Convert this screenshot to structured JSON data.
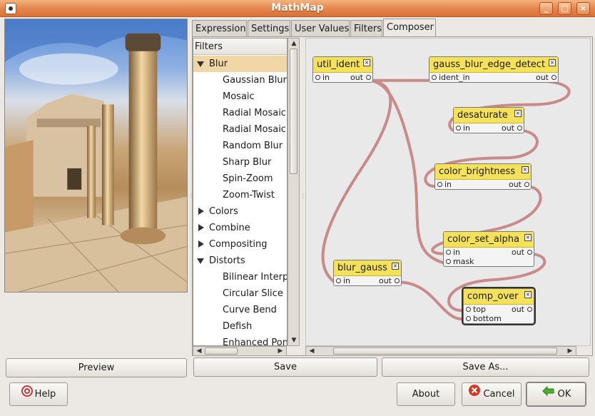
{
  "window": {
    "title": "MathMap",
    "minimize": "_",
    "maximize": "□",
    "close": "×"
  },
  "tabs": [
    "Expression",
    "Settings",
    "User Values",
    "Filters",
    "Composer"
  ],
  "filters": {
    "header": "Filters",
    "rows": [
      {
        "label": "Blur",
        "expander": "down",
        "selected": true
      },
      {
        "label": "Gaussian Blur"
      },
      {
        "label": "Mosaic"
      },
      {
        "label": "Radial Mosaic"
      },
      {
        "label": "Radial Mosaic"
      },
      {
        "label": "Random Blur"
      },
      {
        "label": "Sharp Blur"
      },
      {
        "label": "Spin-Zoom"
      },
      {
        "label": "Zoom-Twist"
      },
      {
        "label": "Colors",
        "expander": "right"
      },
      {
        "label": "Combine",
        "expander": "right"
      },
      {
        "label": "Compositing",
        "expander": "right"
      },
      {
        "label": "Distorts",
        "expander": "down"
      },
      {
        "label": "Bilinear Interpo"
      },
      {
        "label": "Circular Slice"
      },
      {
        "label": "Curve Bend"
      },
      {
        "label": "Defish"
      },
      {
        "label": "Enhanced Pon"
      }
    ]
  },
  "composer": {
    "nodes": {
      "util_ident": {
        "title": "util_ident",
        "in": "in",
        "out": "out"
      },
      "gauss_blur_edge_detect": {
        "title": "gauss_blur_edge_detect",
        "in": "ident_in",
        "out": "out"
      },
      "desaturate": {
        "title": "desaturate",
        "in": "in",
        "out": "out"
      },
      "color_brightness": {
        "title": "color_brightness",
        "in": "in",
        "out": "out"
      },
      "color_set_alpha": {
        "title": "color_set_alpha",
        "in": "in",
        "in2": "mask",
        "out": "out"
      },
      "blur_gauss": {
        "title": "blur_gauss",
        "in": "in",
        "out": "out"
      },
      "comp_over": {
        "title": "comp_over",
        "in": "top",
        "in2": "bottom",
        "out": "out"
      }
    },
    "close_glyph": "×",
    "wire_color": "#c98a8a"
  },
  "buttons": {
    "preview": "Preview",
    "save": "Save",
    "save_as": "Save As...",
    "help": "Help",
    "about": "About",
    "cancel": "Cancel",
    "ok": "OK"
  }
}
